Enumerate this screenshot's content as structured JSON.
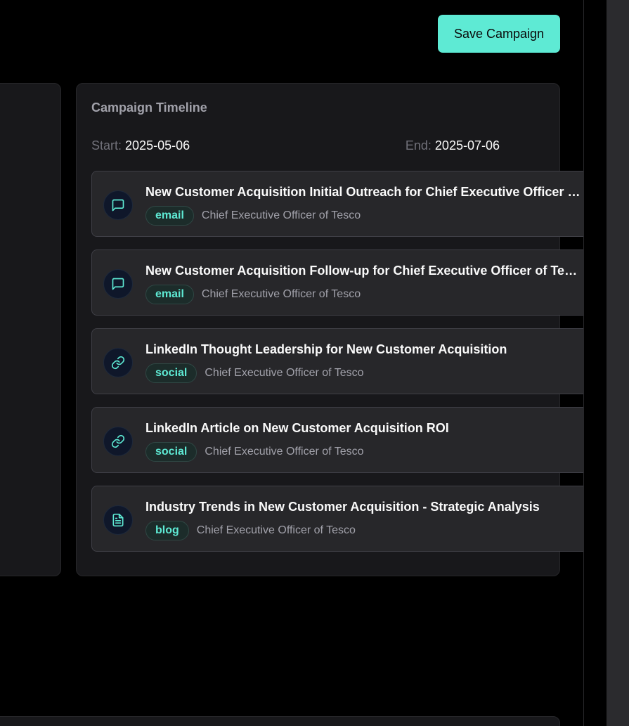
{
  "header": {
    "save_label": "Save Campaign"
  },
  "timeline": {
    "title": "Campaign Timeline",
    "start_label": "Start:",
    "start_value": "2025-05-06",
    "end_label": "End:",
    "end_value": "2025-07-06",
    "items": [
      {
        "title": "New Customer Acquisition Initial Outreach for Chief Executive Officer of Tesco",
        "type": "email",
        "icon": "message-icon",
        "audience": "Chief Executive Officer of Tesco"
      },
      {
        "title": "New Customer Acquisition Follow-up for Chief Executive Officer of Tesco",
        "type": "email",
        "icon": "message-icon",
        "audience": "Chief Executive Officer of Tesco"
      },
      {
        "title": "LinkedIn Thought Leadership for New Customer Acquisition",
        "type": "social",
        "icon": "link-icon",
        "audience": "Chief Executive Officer of Tesco"
      },
      {
        "title": "LinkedIn Article on New Customer Acquisition ROI",
        "type": "social",
        "icon": "link-icon",
        "audience": "Chief Executive Officer of Tesco"
      },
      {
        "title": "Industry Trends in New Customer Acquisition - Strategic Analysis",
        "type": "blog",
        "icon": "document-icon",
        "audience": "Chief Executive Officer of Tesco"
      }
    ]
  },
  "colors": {
    "accent": "#5eead4",
    "background": "#000000",
    "card": "#18181b",
    "item": "#27272a"
  }
}
